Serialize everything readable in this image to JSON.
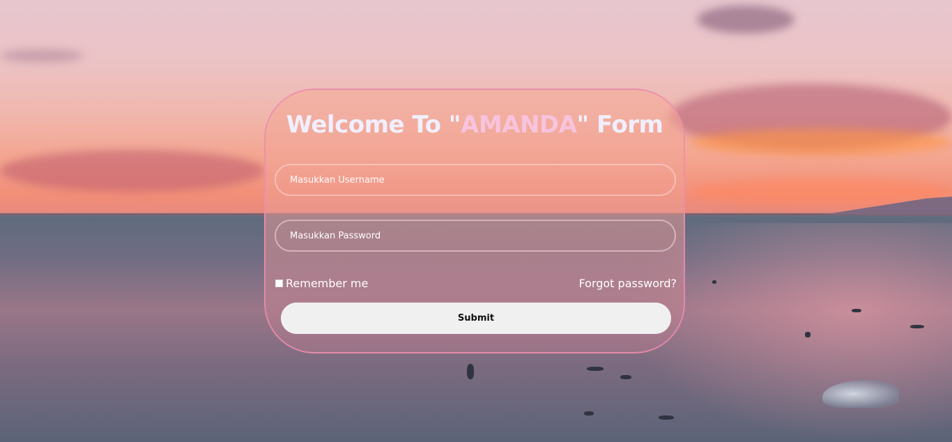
{
  "background": {
    "image": "sunset-beach-photo",
    "accent": "#f28f78"
  },
  "form": {
    "title_prefix": "Welcome To \"",
    "title_brand": "AMANDA",
    "title_suffix": "\" Form",
    "brand_color": "#f8c3dd",
    "username_placeholder": "Masukkan Username",
    "password_placeholder": "Masukkan Password",
    "remember_label": "Remember me",
    "remember_checked": false,
    "forgot_label": "Forgot password?",
    "submit_label": "Submit"
  }
}
